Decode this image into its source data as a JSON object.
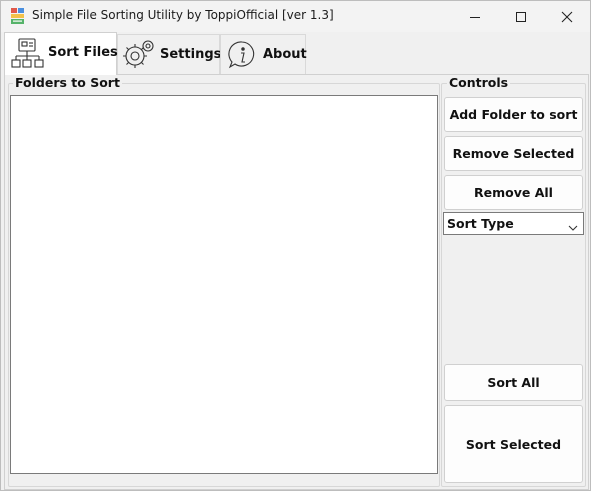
{
  "window": {
    "title": "Simple File Sorting Utility by ToppiOfficial [ver 1.3]",
    "app_icon": "app-logo-icon",
    "controls": [
      "minimize-icon",
      "maximize-icon",
      "close-icon"
    ]
  },
  "tabs": [
    {
      "label": "Sort Files",
      "icon": "folder-tree-icon",
      "active": true
    },
    {
      "label": "Settings",
      "icon": "gear-icon",
      "active": false
    },
    {
      "label": "About",
      "icon": "info-icon",
      "active": false
    }
  ],
  "folders_group": {
    "label": "Folders to Sort",
    "items": []
  },
  "controls_group": {
    "label": "Controls",
    "add_folder_label": "Add Folder to sort",
    "remove_selected_label": "Remove Selected",
    "remove_all_label": "Remove All",
    "sort_type": {
      "selected": "Sort Type"
    },
    "sort_all_label": "Sort All",
    "sort_selected_label": "Sort Selected"
  },
  "colors": {
    "window_bg": "#f0f0f0",
    "list_bg": "#ffffff",
    "border": "#7a7a7a"
  }
}
